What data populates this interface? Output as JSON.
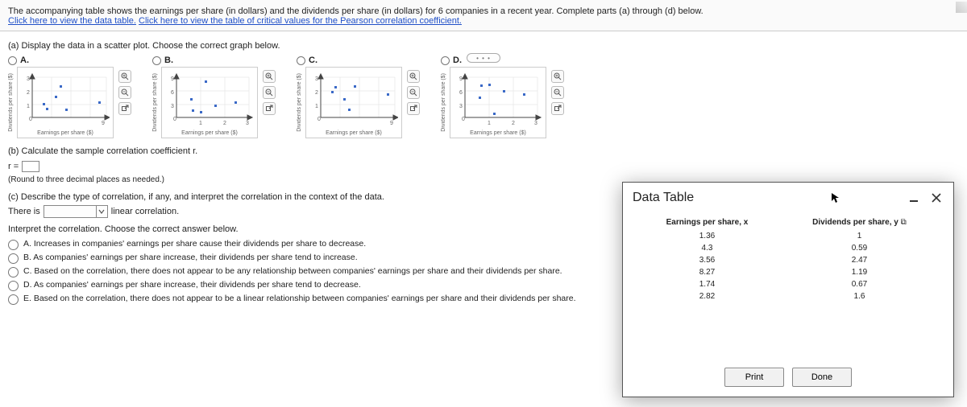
{
  "header": {
    "intro": "The accompanying table shows the earnings per share (in dollars) and the dividends per share (in dollars) for 6 companies in a recent year. Complete parts (a) through (d) below.",
    "link1": "Click here to view the data table.",
    "link2": "Click here to view the table of critical values for the Pearson correlation coefficient."
  },
  "partA": {
    "prompt": "(a) Display the data in a scatter plot. Choose the correct graph below.",
    "options": [
      {
        "label": "A.",
        "xmax": 9,
        "ymax": 3,
        "xticks": [
          "0",
          "9"
        ],
        "yticks": [
          "0",
          "1",
          "2",
          "3"
        ]
      },
      {
        "label": "B.",
        "xmax": 3,
        "ymax": 9,
        "xticks": [
          "0",
          "1",
          "2",
          "3"
        ],
        "yticks": [
          "0",
          "3",
          "6",
          "9"
        ]
      },
      {
        "label": "C.",
        "xmax": 9,
        "ymax": 3,
        "xticks": [
          "0",
          "9"
        ],
        "yticks": [
          "0",
          "1",
          "2",
          "3"
        ]
      },
      {
        "label": "D.",
        "xmax": 3,
        "ymax": 9,
        "xticks": [
          "0",
          "1",
          "2",
          "3"
        ],
        "yticks": [
          "0",
          "3",
          "6",
          "9"
        ]
      }
    ],
    "xlabel": "Earnings per share ($)",
    "ylabel": "Dividends per share ($)"
  },
  "partB": {
    "prompt": "(b) Calculate the sample correlation coefficient r.",
    "r_label": "r =",
    "r_value": "",
    "hint": "(Round to three decimal places as needed.)"
  },
  "partC": {
    "prompt": "(c) Describe the type of correlation, if any, and interpret the correlation in the context of the data.",
    "thereis": "There is",
    "select1_placeholder": "",
    "after_select": "linear correlation.",
    "interpret_prompt": "Interpret the correlation. Choose the correct answer below.",
    "choices": [
      "A.  Increases in companies' earnings per share cause their dividends per share to decrease.",
      "B.  As companies' earnings per share increase, their dividends per share tend to increase.",
      "C.  Based on the correlation, there does not appear to be any relationship between companies' earnings per share and their dividends per share.",
      "D.  As companies' earnings per share increase, their dividends per share tend to decrease.",
      "E.  Based on the correlation, there does not appear to be a linear relationship between companies' earnings per share and their dividends per share."
    ]
  },
  "modal": {
    "title": "Data Table",
    "col1": "Earnings per share, x",
    "col2": "Dividends per share, y",
    "rows": [
      {
        "x": "1.36",
        "y": "1"
      },
      {
        "x": "4.3",
        "y": "0.59"
      },
      {
        "x": "3.56",
        "y": "2.47"
      },
      {
        "x": "8.27",
        "y": "1.19"
      },
      {
        "x": "1.74",
        "y": "0.67"
      },
      {
        "x": "2.82",
        "y": "1.6"
      }
    ],
    "print": "Print",
    "done": "Done"
  },
  "chart_data": {
    "type": "scatter",
    "title": "",
    "xlabel": "Earnings per share ($)",
    "ylabel": "Dividends per share ($)",
    "series": [
      {
        "name": "companies",
        "x": [
          1.36,
          4.3,
          3.56,
          8.27,
          1.74,
          2.82
        ],
        "y": [
          1,
          0.59,
          2.47,
          1.19,
          0.67,
          1.6
        ]
      }
    ],
    "xlim": [
      0,
      9
    ],
    "ylim": [
      0,
      3
    ]
  }
}
